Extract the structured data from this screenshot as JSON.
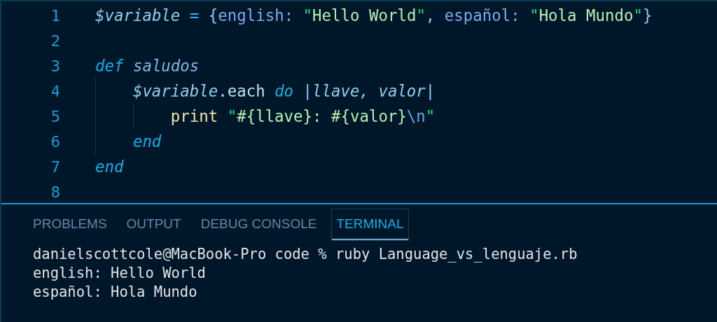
{
  "editor": {
    "lines": [
      {
        "number": "1",
        "tokens": [
          {
            "text": "$variable",
            "kind": "variable"
          },
          {
            "text": " = ",
            "kind": "operator"
          },
          {
            "text": "{",
            "kind": "punct"
          },
          {
            "text": "english: ",
            "kind": "key"
          },
          {
            "text": "\"",
            "kind": "quote"
          },
          {
            "text": "Hello World",
            "kind": "string"
          },
          {
            "text": "\"",
            "kind": "quote"
          },
          {
            "text": ", ",
            "kind": "punct"
          },
          {
            "text": "español: ",
            "kind": "key"
          },
          {
            "text": "\"",
            "kind": "quote"
          },
          {
            "text": "Hola Mundo",
            "kind": "string"
          },
          {
            "text": "\"",
            "kind": "quote"
          },
          {
            "text": "}",
            "kind": "punct"
          }
        ]
      },
      {
        "number": "2"
      },
      {
        "number": "3",
        "tokens": [
          {
            "text": "def",
            "kind": "keyword"
          },
          {
            "text": " saludos",
            "kind": "function"
          }
        ],
        "children": [
          {
            "number": "4",
            "tokens": [
              {
                "text": "$variable",
                "kind": "variable"
              },
              {
                "text": ".each ",
                "kind": "plain"
              },
              {
                "text": "do",
                "kind": "keyword"
              },
              {
                "text": " |",
                "kind": "punct"
              },
              {
                "text": "llave, valor",
                "kind": "param"
              },
              {
                "text": "|",
                "kind": "punct"
              }
            ],
            "children": [
              {
                "number": "5",
                "tokens": [
                  {
                    "text": "print ",
                    "kind": "builtin"
                  },
                  {
                    "text": "\"",
                    "kind": "quote"
                  },
                  {
                    "text": "#{llave}: #{valor}",
                    "kind": "string"
                  },
                  {
                    "text": "\\n",
                    "kind": "escape"
                  },
                  {
                    "text": "\"",
                    "kind": "quote"
                  }
                ]
              }
            ]
          },
          {
            "number": "6",
            "tokens": [
              {
                "text": "end",
                "kind": "keyword"
              }
            ]
          }
        ]
      },
      {
        "number": "7",
        "tokens": [
          {
            "text": "end",
            "kind": "keyword"
          }
        ]
      },
      {
        "number": "8"
      }
    ]
  },
  "panel": {
    "tabs": [
      {
        "label": "PROBLEMS",
        "selected": false
      },
      {
        "label": "OUTPUT",
        "selected": false
      },
      {
        "label": "DEBUG CONSOLE",
        "selected": false
      },
      {
        "label": "TERMINAL",
        "selected": true
      }
    ],
    "terminal_lines": [
      "danielscottcole@MacBook-Pro code % ruby Language_vs_lenguaje.rb",
      "english: Hello World",
      "español: Hola Mundo"
    ]
  }
}
